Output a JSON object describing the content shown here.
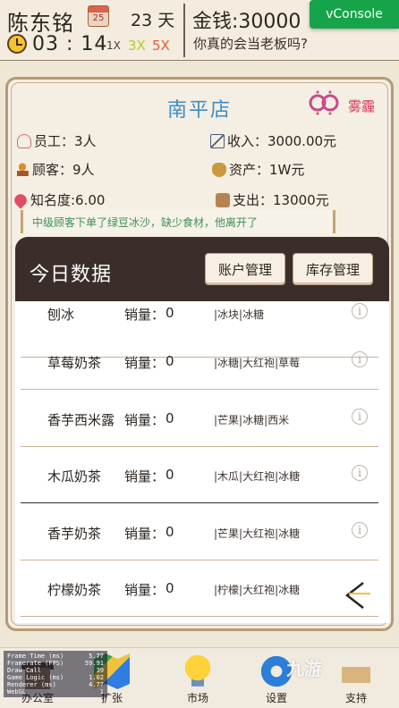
{
  "topbar": {
    "player_name": "陈东铭",
    "calendar_day": "25",
    "day_count": "23 天",
    "time": "03 : 14",
    "speed_1x": "1X",
    "speed_3x": "3X",
    "speed_5x": "5X",
    "money": "金钱:30000",
    "subtitle": "你真的会当老板吗?",
    "vconsole": "vConsole"
  },
  "shop": {
    "title": "南平店",
    "weather": "雾霾",
    "staff": "员工：3人",
    "customers": "顾客：9人",
    "fame": "知名度:6.00",
    "income": "收入：3000.00元",
    "assets": "资产：1W元",
    "expense": "支出：13000元",
    "news": "中级顾客下单了绿豆冰沙，缺少食材，他离开了"
  },
  "today": {
    "title": "今日数据",
    "btn_account": "账户管理",
    "btn_stock": "库存管理",
    "sales_label": "销量：",
    "rows": [
      {
        "name": "刨冰",
        "sales": "0",
        "ingredients": "|冰块|冰糖"
      },
      {
        "name": "草莓奶茶",
        "sales": "0",
        "ingredients": "|冰糖|大红袍|草莓"
      },
      {
        "name": "香芋西米露",
        "sales": "0",
        "ingredients": "|芒果|冰糖|西米"
      },
      {
        "name": "木瓜奶茶",
        "sales": "0",
        "ingredients": "|木瓜|大红袍|冰糖"
      },
      {
        "name": "香芋奶茶",
        "sales": "0",
        "ingredients": "|芒果|大红袍|冰糖"
      },
      {
        "name": "柠檬奶茶",
        "sales": "0",
        "ingredients": "|柠檬|大红袍|冰糖"
      }
    ]
  },
  "nav": {
    "office": "办公室",
    "expand": "扩张",
    "market": "市场",
    "settings": "设置",
    "support": "支持"
  },
  "debug": [
    {
      "k": "Frame Time (ms)",
      "v": "5.77"
    },
    {
      "k": "Framerate (FPS)",
      "v": "59.91"
    },
    {
      "k": "Draw Call",
      "v": "39"
    },
    {
      "k": "Game Logic (ms)",
      "v": "1.02"
    },
    {
      "k": "Renderer (ms)",
      "v": "4.77"
    },
    {
      "k": "WebGL",
      "v": "1"
    }
  ],
  "watermark": "九游",
  "colors": {
    "title_blue": "#3c8ec6",
    "speed_3x": "#b6c92e",
    "speed_5x": "#e8593b",
    "news_green": "#3e8f5d",
    "vconsole_green": "#16a34a",
    "weather_pink": "#d8335e",
    "panel_dark": "#3b2e2a"
  }
}
